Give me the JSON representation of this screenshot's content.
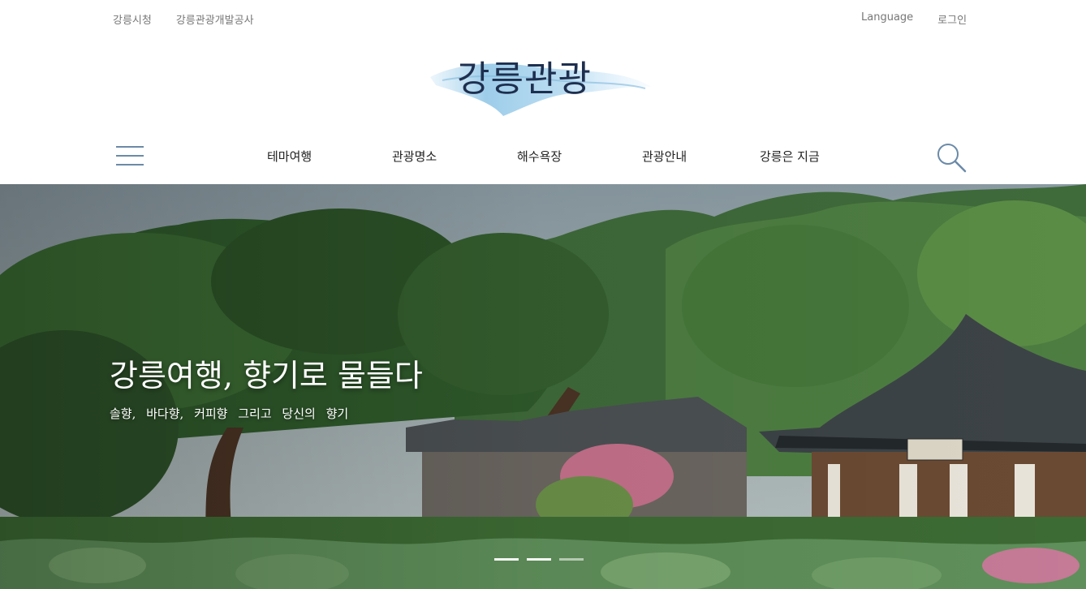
{
  "utility": {
    "left_links": [
      "강릉시청",
      "강릉관광개발공사"
    ],
    "language": "Language",
    "login": "로그인"
  },
  "logo": {
    "text": "강릉관광"
  },
  "nav": {
    "items": [
      "테마여행",
      "관광명소",
      "해수욕장",
      "관광안내",
      "강릉은 지금"
    ],
    "menu_icon": "hamburger-menu-icon",
    "search_icon": "search-icon"
  },
  "hero": {
    "title": "강릉여행, 향기로 물들다",
    "subtitle": "솔향, 바다향, 커피향 그리고 당신의 향기",
    "slides": 3,
    "active_slide": 1
  },
  "colors": {
    "logo_text": "#1e2f4f",
    "accent": "#6b8aa8",
    "nav_text": "#222222",
    "util_text": "#777777"
  }
}
